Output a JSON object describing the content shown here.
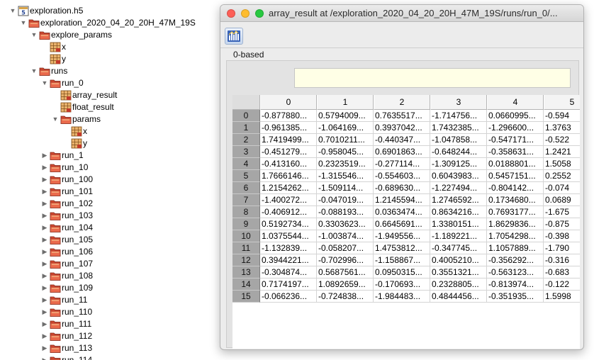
{
  "tree": {
    "rows": [
      {
        "label": "exploration.h5",
        "depth": 0,
        "icon": "h5-file-icon",
        "state": "open"
      },
      {
        "label": "exploration_2020_04_20_20H_47M_19S",
        "depth": 1,
        "icon": "folder-icon",
        "state": "open"
      },
      {
        "label": "explore_params",
        "depth": 2,
        "icon": "folder-icon",
        "state": "open"
      },
      {
        "label": "x",
        "depth": 3,
        "icon": "dataset-icon",
        "state": "leaf"
      },
      {
        "label": "y",
        "depth": 3,
        "icon": "dataset-icon",
        "state": "leaf"
      },
      {
        "label": "runs",
        "depth": 2,
        "icon": "folder-icon",
        "state": "open"
      },
      {
        "label": "run_0",
        "depth": 3,
        "icon": "folder-icon",
        "state": "open"
      },
      {
        "label": "array_result",
        "depth": 4,
        "icon": "dataset-icon",
        "state": "leaf"
      },
      {
        "label": "float_result",
        "depth": 4,
        "icon": "dataset-icon",
        "state": "leaf"
      },
      {
        "label": "params",
        "depth": 4,
        "icon": "folder-icon",
        "state": "open"
      },
      {
        "label": "x",
        "depth": 5,
        "icon": "dataset-icon",
        "state": "leaf"
      },
      {
        "label": "y",
        "depth": 5,
        "icon": "dataset-icon",
        "state": "leaf"
      },
      {
        "label": "run_1",
        "depth": 3,
        "icon": "folder-icon",
        "state": "closed"
      },
      {
        "label": "run_10",
        "depth": 3,
        "icon": "folder-icon",
        "state": "closed"
      },
      {
        "label": "run_100",
        "depth": 3,
        "icon": "folder-icon",
        "state": "closed"
      },
      {
        "label": "run_101",
        "depth": 3,
        "icon": "folder-icon",
        "state": "closed"
      },
      {
        "label": "run_102",
        "depth": 3,
        "icon": "folder-icon",
        "state": "closed"
      },
      {
        "label": "run_103",
        "depth": 3,
        "icon": "folder-icon",
        "state": "closed"
      },
      {
        "label": "run_104",
        "depth": 3,
        "icon": "folder-icon",
        "state": "closed"
      },
      {
        "label": "run_105",
        "depth": 3,
        "icon": "folder-icon",
        "state": "closed"
      },
      {
        "label": "run_106",
        "depth": 3,
        "icon": "folder-icon",
        "state": "closed"
      },
      {
        "label": "run_107",
        "depth": 3,
        "icon": "folder-icon",
        "state": "closed"
      },
      {
        "label": "run_108",
        "depth": 3,
        "icon": "folder-icon",
        "state": "closed"
      },
      {
        "label": "run_109",
        "depth": 3,
        "icon": "folder-icon",
        "state": "closed"
      },
      {
        "label": "run_11",
        "depth": 3,
        "icon": "folder-icon",
        "state": "closed"
      },
      {
        "label": "run_110",
        "depth": 3,
        "icon": "folder-icon",
        "state": "closed"
      },
      {
        "label": "run_111",
        "depth": 3,
        "icon": "folder-icon",
        "state": "closed"
      },
      {
        "label": "run_112",
        "depth": 3,
        "icon": "folder-icon",
        "state": "closed"
      },
      {
        "label": "run_113",
        "depth": 3,
        "icon": "folder-icon",
        "state": "closed"
      },
      {
        "label": "run_114",
        "depth": 3,
        "icon": "folder-icon",
        "state": "closed"
      }
    ]
  },
  "window": {
    "title": "array_result  at  /exploration_2020_04_20_20H_47M_19S/runs/run_0/...",
    "toolbar_icon": "chart-icon",
    "index_label": "0-based",
    "cell_editor_value": "",
    "colors": {
      "close": "#fd5f57",
      "minimize": "#febc2e",
      "zoom": "#28c840"
    }
  },
  "table": {
    "columns": [
      "0",
      "1",
      "2",
      "3",
      "4",
      "5"
    ],
    "row_labels": [
      "0",
      "1",
      "2",
      "3",
      "4",
      "5",
      "6",
      "7",
      "8",
      "9",
      "10",
      "11",
      "12",
      "13",
      "14",
      "15"
    ],
    "rows": [
      [
        "-0.877880...",
        "0.5794009...",
        "0.7635517...",
        "-1.714756...",
        "0.0660995...",
        "-0.594"
      ],
      [
        "-0.961385...",
        "-1.064169...",
        "0.3937042...",
        "1.7432385...",
        "-1.296600...",
        "1.3763"
      ],
      [
        "1.7419499...",
        "0.7010211...",
        "-0.440347...",
        "-1.047858...",
        "-0.547171...",
        "-0.522"
      ],
      [
        "-0.451279...",
        "-0.958045...",
        "0.6901863...",
        "-0.648244...",
        "-0.358631...",
        "1.2421"
      ],
      [
        "-0.413160...",
        "0.2323519...",
        "-0.277114...",
        "-1.309125...",
        "0.0188801...",
        "1.5058"
      ],
      [
        "1.7666146...",
        "-1.315546...",
        "-0.554603...",
        "0.6043983...",
        "0.5457151...",
        "0.2552"
      ],
      [
        "1.2154262...",
        "-1.509114...",
        "-0.689630...",
        "-1.227494...",
        "-0.804142...",
        "-0.074"
      ],
      [
        "-1.400272...",
        "-0.047019...",
        "1.2145594...",
        "1.2746592...",
        "0.1734680...",
        "0.0689"
      ],
      [
        "-0.406912...",
        "-0.088193...",
        "0.0363474...",
        "0.8634216...",
        "0.7693177...",
        "-1.675"
      ],
      [
        "0.5192734...",
        "0.3303623...",
        "0.6645691...",
        "1.3380151...",
        "1.8629836...",
        "-0.875"
      ],
      [
        "1.0375544...",
        "-1.003874...",
        "-1.949556...",
        "-1.189221...",
        "1.7054298...",
        "-0.398"
      ],
      [
        "-1.132839...",
        "-0.058207...",
        "1.4753812...",
        "-0.347745...",
        "1.1057889...",
        "-1.790"
      ],
      [
        "0.3944221...",
        "-0.702996...",
        "-1.158867...",
        "0.4005210...",
        "-0.356292...",
        "-0.316"
      ],
      [
        "-0.304874...",
        "0.5687561...",
        "0.0950315...",
        "0.3551321...",
        "-0.563123...",
        "-0.683"
      ],
      [
        "0.7174197...",
        "1.0892659...",
        "-0.170693...",
        "0.2328805...",
        "-0.813974...",
        "-0.122"
      ],
      [
        "-0.066236...",
        "-0.724838...",
        "-1.984483...",
        "0.4844456...",
        "-0.351935...",
        "1.5998"
      ]
    ]
  }
}
